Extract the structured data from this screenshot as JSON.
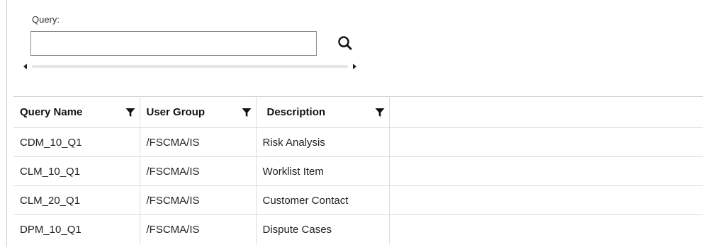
{
  "search": {
    "label": "Query:",
    "value": "",
    "placeholder": ""
  },
  "table": {
    "columns": [
      {
        "label": "Query Name",
        "icon": "filter-icon"
      },
      {
        "label": "User Group",
        "icon": "filter-icon"
      },
      {
        "label": "Description",
        "icon": "filter-icon"
      }
    ],
    "rows": [
      {
        "query_name": "CDM_10_Q1",
        "user_group": "/FSCMA/IS",
        "description": "Risk Analysis"
      },
      {
        "query_name": "CLM_10_Q1",
        "user_group": "/FSCMA/IS",
        "description": "Worklist Item"
      },
      {
        "query_name": "CLM_20_Q1",
        "user_group": "/FSCMA/IS",
        "description": "Customer Contact"
      },
      {
        "query_name": "DPM_10_Q1",
        "user_group": "/FSCMA/IS",
        "description": "Dispute Cases"
      }
    ]
  }
}
